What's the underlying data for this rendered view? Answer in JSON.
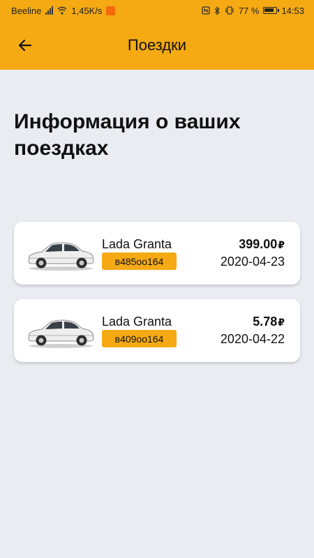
{
  "status_bar": {
    "carrier": "Beeline",
    "speed": "1,45K/s",
    "battery_percent": "77 %",
    "time": "14:53"
  },
  "app_bar": {
    "title": "Поездки",
    "back_icon": "arrow-left-icon"
  },
  "page": {
    "heading": "Информация о ваших поездках"
  },
  "trips": [
    {
      "car": "Lada Granta",
      "plate": "в485оо164",
      "price": "399.00",
      "currency": "₽",
      "date": "2020-04-23"
    },
    {
      "car": "Lada Granta",
      "plate": "в409оо164",
      "price": "5.78",
      "currency": "₽",
      "date": "2020-04-22"
    }
  ],
  "colors": {
    "accent": "#f5aa14",
    "background": "#e9edf1",
    "card": "#ffffff"
  }
}
